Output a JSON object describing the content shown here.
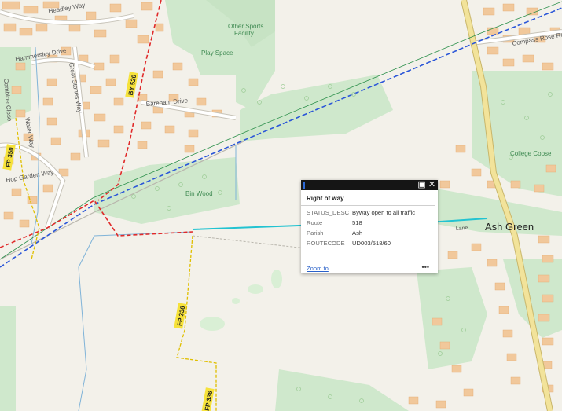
{
  "map": {
    "labels": {
      "headley_way": "Headley Way",
      "hammersley_drive": "Hammersley Drive",
      "great_stones_way": "Great Stones Way",
      "other_sports_facility_1": "Other Sports",
      "other_sports_facility_2": "Facility",
      "play_space": "Play Space",
      "bareham_drive": "Bareham Drive",
      "combine_close": "Combine Close",
      "water_way": "Water Way",
      "hop_garden_way": "Hop Garden Way",
      "bin_wood": "Bin Wood",
      "compass_rose_road": "Compass Rose Road",
      "college_copse": "College Copse",
      "ash_green": "Ash Green",
      "lane_fragment": "Lane"
    },
    "route_badges": {
      "by520": "BY 520",
      "fp350": "FP 350",
      "fp336_upper": "FP 336",
      "fp336_lower": "FP 336"
    },
    "colors": {
      "background": "#f3f1ea",
      "woodland": "#cfe8cc",
      "building": "#f1c89b",
      "bridleway_red": "#e02a2a",
      "railway_blue": "#2b56d8",
      "footpath_yellow": "#f0d000",
      "water": "#7fb3d8",
      "road_main": "#e6d27c",
      "highlight_cyan": "#22c3d1"
    }
  },
  "popup": {
    "title": "Right of way",
    "header_icons": {
      "maximize": "maximize-icon",
      "close": "close-icon"
    },
    "attributes": [
      {
        "key": "STATUS_DESC",
        "value": "Byway open to all traffic"
      },
      {
        "key": "Route",
        "value": "518"
      },
      {
        "key": "Parish",
        "value": "Ash"
      },
      {
        "key": "ROUTECODE",
        "value": "UD003/518/60"
      }
    ],
    "zoom_label": "Zoom to",
    "more_label": "•••"
  }
}
